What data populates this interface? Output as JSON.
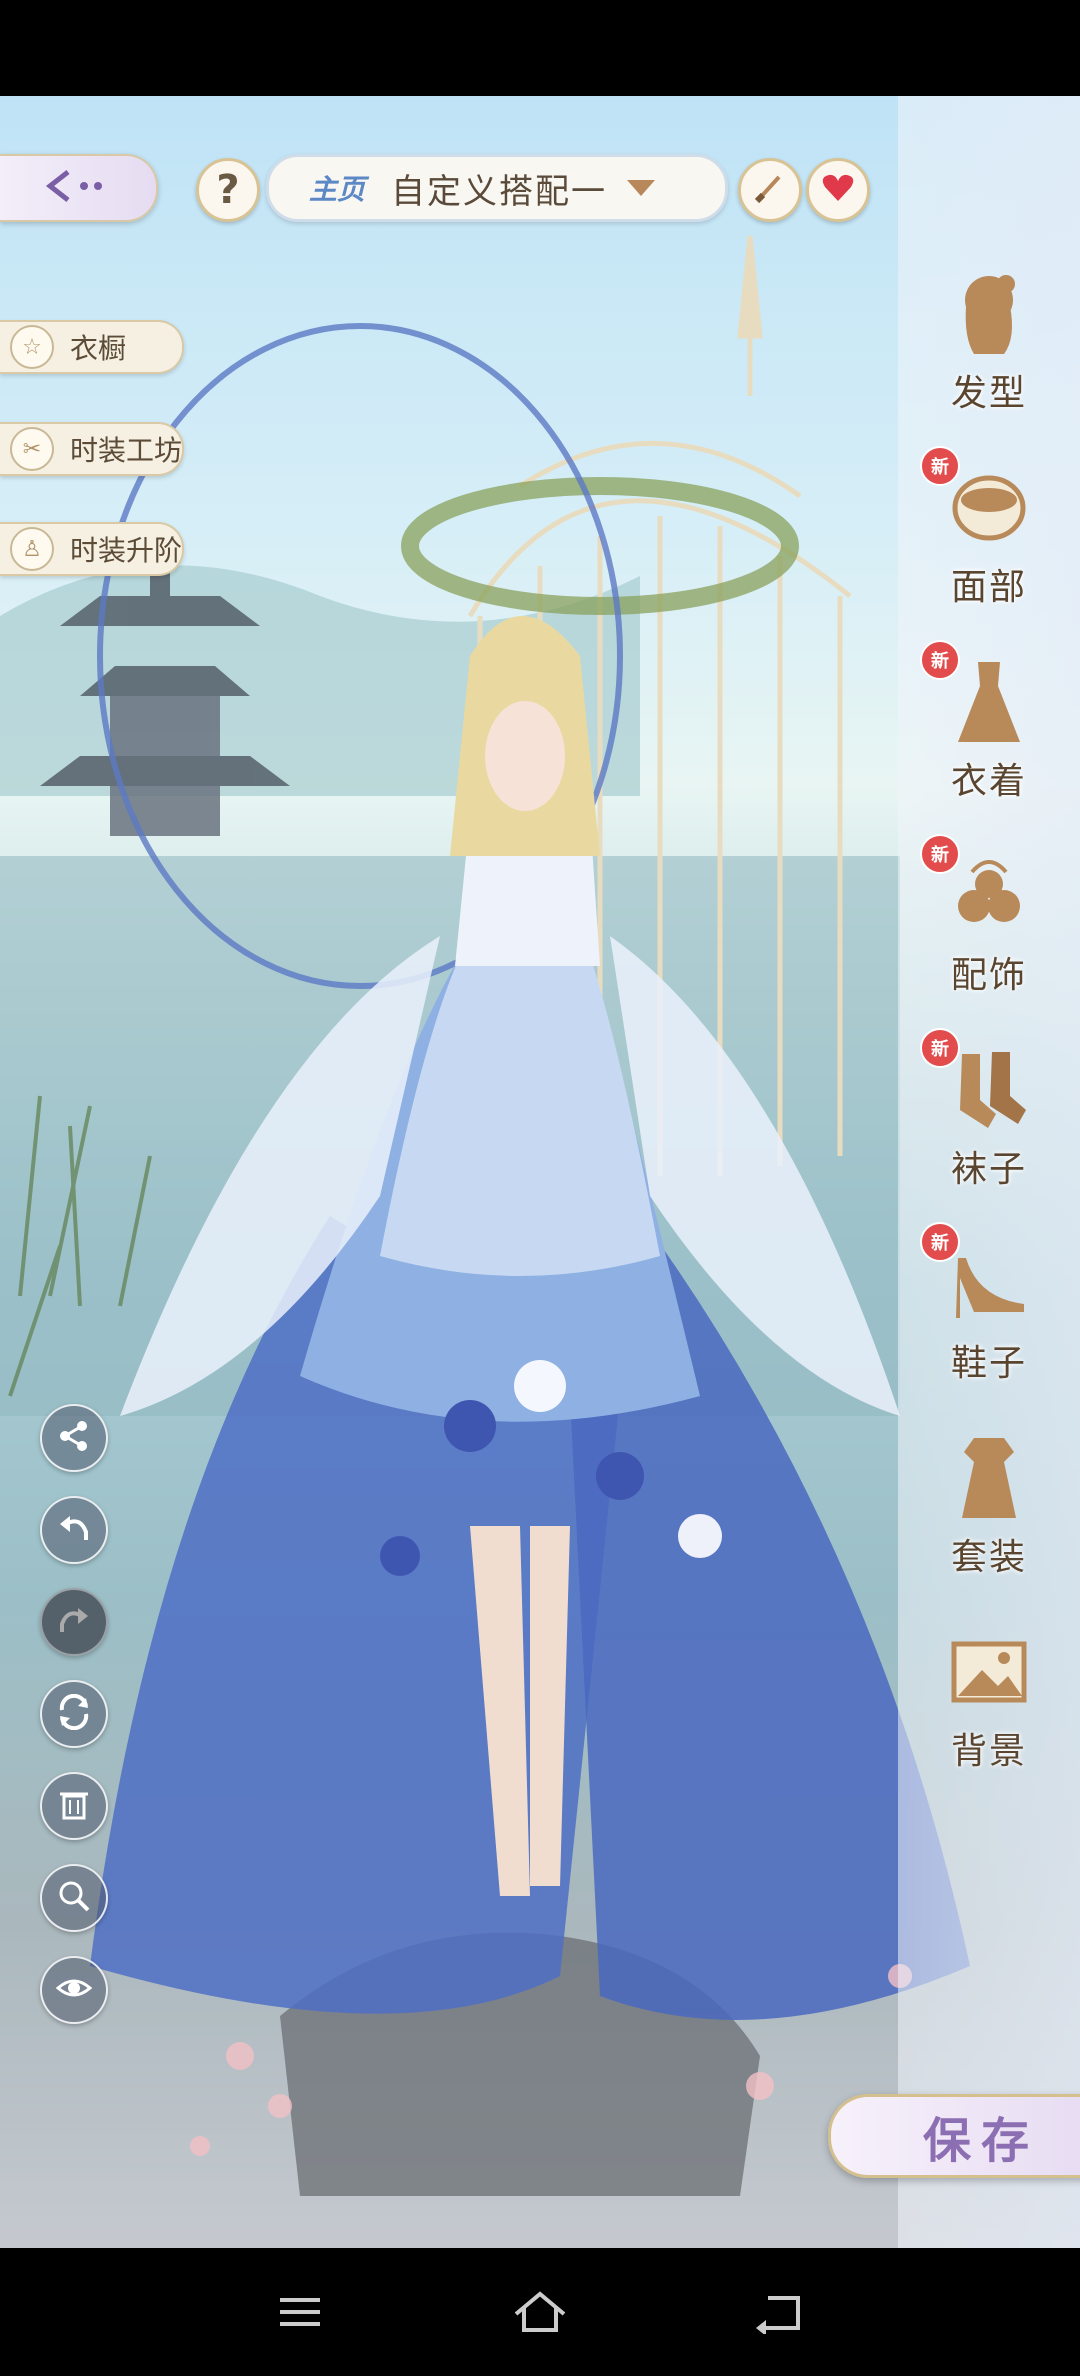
{
  "header": {
    "outfit_tag": "主页",
    "outfit_name": "自定义搭配一",
    "help_label": "?"
  },
  "sidebar": {
    "wardrobe": "衣橱",
    "workshop": "时装工坊",
    "upgrade": "时装升阶"
  },
  "categories": [
    {
      "label": "发型",
      "icon": "hairstyle-icon",
      "new": false
    },
    {
      "label": "面部",
      "icon": "face-makeup-icon",
      "new": true
    },
    {
      "label": "衣着",
      "icon": "dress-icon",
      "new": true
    },
    {
      "label": "配饰",
      "icon": "accessory-icon",
      "new": true
    },
    {
      "label": "袜子",
      "icon": "socks-icon",
      "new": true
    },
    {
      "label": "鞋子",
      "icon": "high-heel-icon",
      "new": true
    },
    {
      "label": "套装",
      "icon": "outfit-set-icon",
      "new": false
    },
    {
      "label": "背景",
      "icon": "background-icon",
      "new": false
    }
  ],
  "badge": {
    "new_label": "新"
  },
  "tools": [
    "share-icon",
    "undo-icon",
    "redo-icon",
    "reset-icon",
    "delete-icon",
    "zoom-icon",
    "view-icon"
  ],
  "save": {
    "label": "保存"
  },
  "colors": {
    "accent": "#8c6fb2",
    "badge": "#e24c4c",
    "gold": "#b8875a",
    "category_icon": "#b88a5a"
  }
}
